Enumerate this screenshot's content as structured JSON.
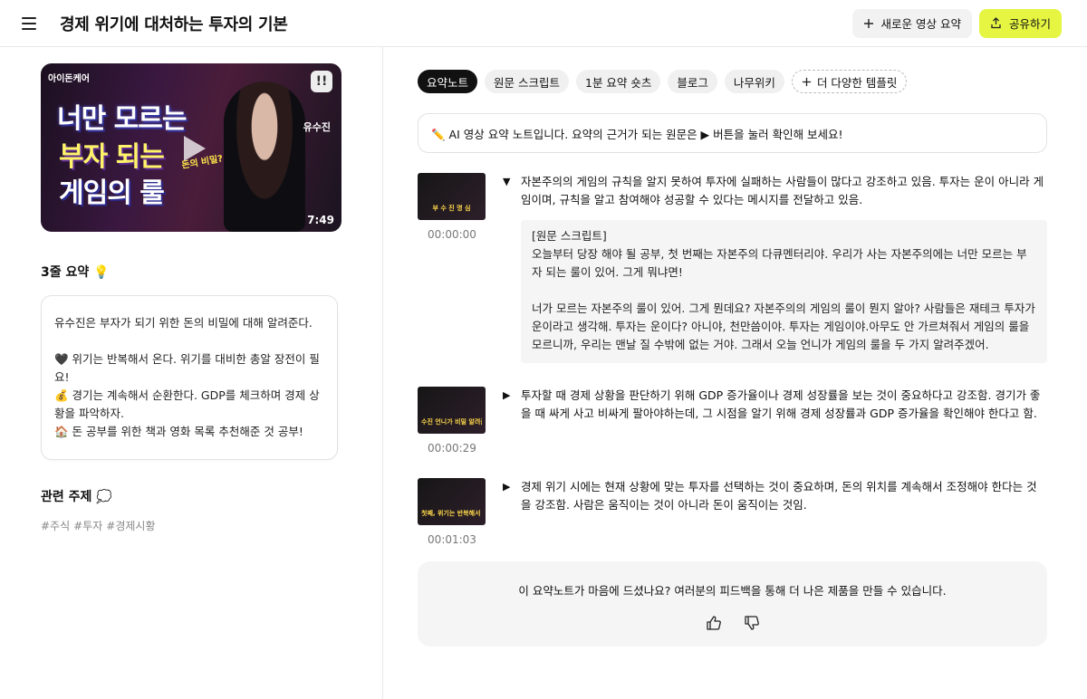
{
  "header": {
    "title": "경제 위기에 대처하는 투자의 기본",
    "new_label": "새로운 영상 요약",
    "share_label": "공유하기"
  },
  "video": {
    "channel_tag": "아이돈케어",
    "line1": "너만 모르는",
    "line2": "부자 되는",
    "line3": "게임의 룰",
    "secret_text": "돈의 비밀?",
    "name": "유수진",
    "duration": "7:49"
  },
  "summary": {
    "title": "3줄 요약 💡",
    "intro": "유수진은 부자가 되기 위한 돈의 비밀에 대해 알려준다.",
    "points": [
      "🖤 위기는 반복해서 온다. 위기를 대비한 총알 장전이 필요!",
      "💰 경기는 계속해서 순환한다. GDP를 체크하며 경제 상황을 파악하자.",
      "🏠 돈 공부를 위한 책과 영화 목록 추천해준 것 공부!"
    ]
  },
  "topics": {
    "title": "관련 주제 💭",
    "tags": [
      "#주식",
      "#투자",
      "#경제시황"
    ]
  },
  "tabs": [
    "요약노트",
    "원문 스크립트",
    "1분 요약 숏츠",
    "블로그",
    "나무위키",
    "더 다양한 템플릿"
  ],
  "notice": "✏️  AI 영상 요약 노트입니다. 요약의 근거가 되는 원문은  ▶ 버튼을 눌러 확인해 보세요!",
  "entries": [
    {
      "timestamp": "00:00:00",
      "thumb_text": "부 수 진 명 심",
      "text": "자본주의의 게임의 규칙을 알지 못하여 투자에 실패하는 사람들이 많다고 강조하고 있음. 투자는 운이 아니라 게임이며, 규칙을 알고 참여해야 성공할 수 있다는 메시지를 전달하고 있음.",
      "transcript_title": "[원문 스크립트]",
      "transcript_p1": "오늘부터 당장 해야 될 공부, 첫 번째는 자본주의 다큐멘터리야. 우리가 사는 자본주의에는 너만 모르는 부자 되는 룰이 있어. 그게 뭐냐면!",
      "transcript_p2": "너가 모르는 자본주의 룰이 있어. 그게 뭔데요? 자본주의의 게임의 룰이 뭔지 알아? 사람들은 재테크 투자가 운이라고 생각해. 투자는 운이다? 아니야, 천만씀이야. 투자는 게임이야.아무도 안 가르쳐줘서 게임의 룰을 모르니까, 우리는 맨날 질 수밖에 없는 거야. 그래서 오늘 언니가 게임의 룰을 두 가지 알려주겠어."
    },
    {
      "timestamp": "00:00:29",
      "thumb_text": "수진 언니가 비밀 알려준다",
      "text": "투자할 때 경제 상황을 판단하기 위해 GDP 증가율이나 경제 성장률을 보는 것이 중요하다고 강조함. 경기가 좋을 때 싸게 사고 비싸게 팔아야하는데, 그 시점을 알기 위해 경제 성장률과 GDP 증가율을 확인해야 한다고 함."
    },
    {
      "timestamp": "00:01:03",
      "thumb_text": "첫째, 위기는 반복해서 온다",
      "text": "경제 위기 시에는 현재 상황에 맞는 투자를 선택하는 것이 중요하며, 돈의 위치를 계속해서 조정해야 한다는 것을 강조함. 사람은 움직이는 것이 아니라 돈이 움직이는 것임."
    }
  ],
  "feedback": {
    "text": "이 요약노트가 마음에 드셨나요? 여러분의 피드백을 통해 더 나은 제품을 만들 수 있습니다."
  }
}
